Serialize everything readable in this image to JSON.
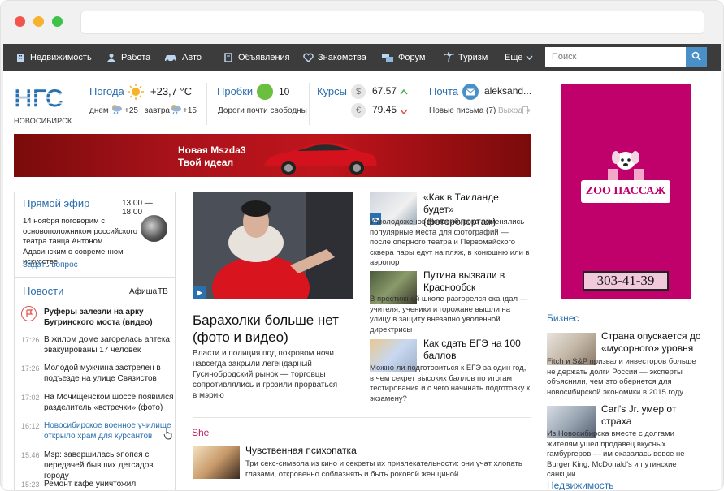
{
  "nav": {
    "items": [
      {
        "label": "Недвижимость",
        "icon": "building-icon"
      },
      {
        "label": "Работа",
        "icon": "work-icon"
      },
      {
        "label": "Авто",
        "icon": "car-icon"
      },
      {
        "label": "Объявления",
        "icon": "ads-icon"
      },
      {
        "label": "Знакомства",
        "icon": "heart-icon"
      },
      {
        "label": "Форум",
        "icon": "forum-icon"
      },
      {
        "label": "Туризм",
        "icon": "palm-icon"
      }
    ],
    "more": "Еще",
    "search_placeholder": "Поиск"
  },
  "header": {
    "city": "НОВОСИБИРСК",
    "weather": {
      "title": "Погода",
      "temp": "+23,7 °C",
      "day_label": "днем",
      "day_temp": "+25",
      "tomorrow_label": "завтра",
      "tomorrow_temp": "+15"
    },
    "traffic": {
      "title": "Пробки",
      "score": "10",
      "status": "Дороги почти свободны"
    },
    "rates": {
      "title": "Курсы",
      "usd": "67.57",
      "eur": "79.45",
      "usd_symbol": "$",
      "eur_symbol": "€"
    },
    "mail": {
      "title": "Почта",
      "user": "aleksand...",
      "new_letters": "Новые письма (7)",
      "logout": "Выход"
    }
  },
  "banner": {
    "line1": "Новая Mszda3",
    "line2": "Твой идеал"
  },
  "ad": {
    "brand": "ZOO ПАССАЖ",
    "phone": "303-41-39"
  },
  "live": {
    "title": "Прямой эфир",
    "time": "13:00 — 18:00",
    "text": "14 ноября поговорим с основоположником российского театра танца Антоном Адасинским о современном искусстве",
    "ask": "Задать вопрос"
  },
  "news": {
    "title": "Новости",
    "tabs": [
      "Афиша",
      "ТВ"
    ],
    "items": [
      {
        "time": "",
        "text": "Руферы залезли на арку Бугринского моста (видео)"
      },
      {
        "time": "17:26",
        "text": "В жилом доме загорелась аптека: эвакуированы 17 человек"
      },
      {
        "time": "17:26",
        "text": "Молодой мужчина застрелен в подъезде на улице Связистов"
      },
      {
        "time": "17:02",
        "text": "На Мочищенском шоссе появился разделитель «встречки» (фото)"
      },
      {
        "time": "16:12",
        "text": "Новосибирское военное училище открыло храм для курсантов"
      },
      {
        "time": "15:46",
        "text": "Мэр: завершилась эпопея с передачей бывших детсадов городу"
      },
      {
        "time": "15:23",
        "text": "Ремонт кафе уничтожил мозаичное"
      }
    ]
  },
  "main": {
    "title": "Барахолки больше нет (фото и видео)",
    "text": "Власти и полиция под покровом ночи навсегда закрыли легендарный Гусинобродский рынок — торговцы сопротивлялись и грозили прорваться в мэрию"
  },
  "articles": [
    {
      "title": "«Как в Таиланде будет» (фоторепортаж)",
      "text": "У молодоженов Новосибирска поменялись популярные места для фотографий — после оперного театра и Первомайского сквера пары едут на пляж, в конюшню или в аэропорт"
    },
    {
      "title": "Путина вызвали в Краснообск",
      "text": "В престижной школе разгорелся скандал — учителя, ученики и горожане вышли на улицу в защиту внезапно уволенной директрисы"
    },
    {
      "title": "Как сдать ЕГЭ на 100 баллов",
      "text": "Можно ли подготовиться к ЕГЭ за один год, в чем секрет высоких баллов по итогам тестирования и с чего начинать подготовку к экзамену?"
    }
  ],
  "she": {
    "label": "She",
    "title": "Чувственная психопатка",
    "text": "Три секс-символа из кино и секреты их привлекательности: они учат хлопать глазами, откровенно соблазнять и быть роковой женщиной"
  },
  "business": {
    "label": "Бизнес",
    "items": [
      {
        "title": "Страна опускается до «мусорного» уровня",
        "text": "Fitch и S&P призвали инвесторов больше не держать долги России — эксперты объяснили, чем это обернется для новосибирской экономики в 2015 году"
      },
      {
        "title": "Carl's Jr. умер от страха",
        "text": "Из Новосибирска вместе с долгами жителям ушел продавец вкусных гамбургеров — им оказалась вовсе не Burger King, McDonald's и путинские санкции"
      }
    ]
  },
  "realty": {
    "label": "Недвижимость"
  },
  "colors": {
    "nav": "#3c3c3c",
    "link": "#2a6fae",
    "accent": "#4a90c8",
    "she": "#c0185e",
    "traffic_green": "#6abf3f"
  }
}
